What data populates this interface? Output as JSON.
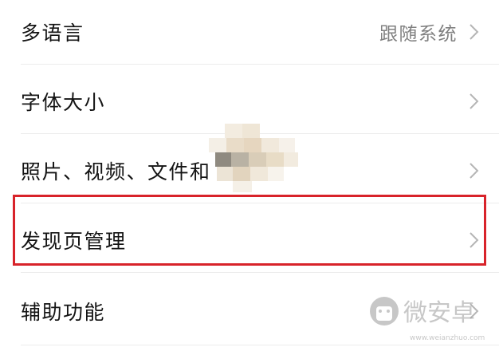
{
  "settings": {
    "rows": [
      {
        "label": "多语言",
        "value": "跟随系统"
      },
      {
        "label": "字体大小"
      },
      {
        "label": "照片、视频、文件和"
      },
      {
        "label": "发现页管理"
      },
      {
        "label": "辅助功能"
      }
    ]
  },
  "highlight": {
    "color": "#d8232a",
    "target_row": "发现页管理"
  },
  "watermark": {
    "text": "微安卓",
    "url": "www.weianzhuo.com"
  },
  "icons": {
    "chevron": "chevron-right-icon",
    "watermark": "android-robot-icon"
  }
}
